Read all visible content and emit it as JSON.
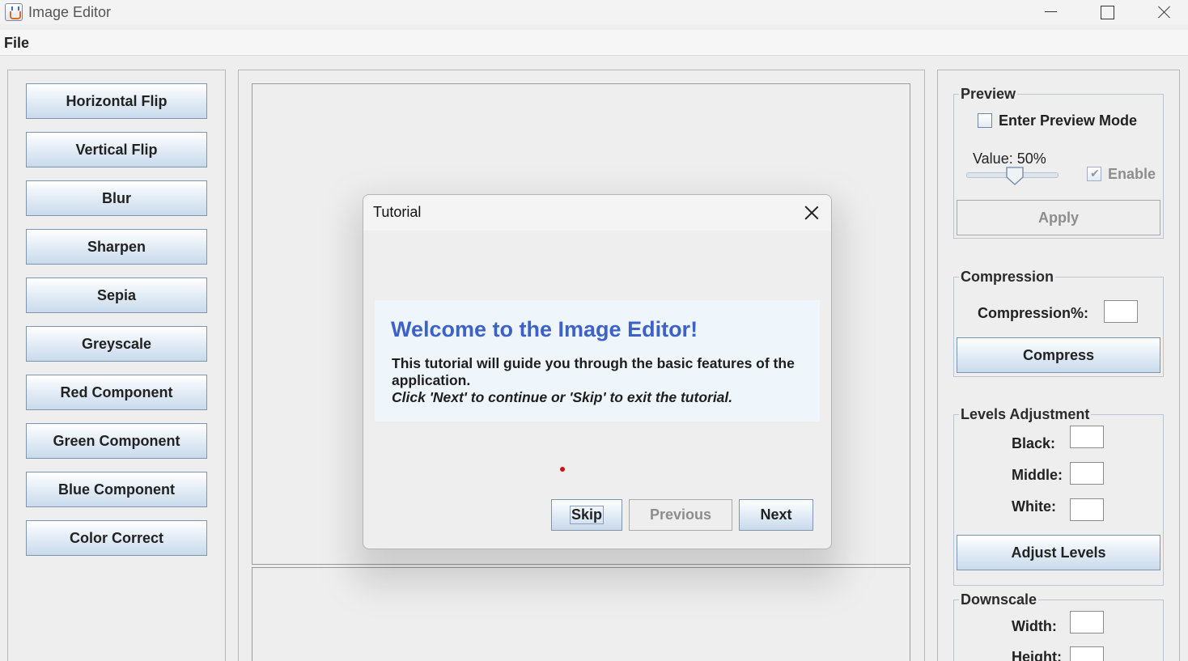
{
  "window": {
    "title": "Image Editor",
    "icon": "java-cup-icon"
  },
  "menu": {
    "file": "File"
  },
  "tools": [
    "Horizontal Flip",
    "Vertical Flip",
    "Blur",
    "Sharpen",
    "Sepia",
    "Greyscale",
    "Red Component",
    "Green Component",
    "Blue Component",
    "Color Correct"
  ],
  "preview": {
    "title": "Preview",
    "mode_label": "Enter Preview Mode",
    "mode_checked": false,
    "value_label": "Value: 50%",
    "value_percent": 50,
    "enable_label": "Enable",
    "enable_checked": true,
    "apply_label": "Apply"
  },
  "compression": {
    "title": "Compression",
    "label": "Compression%:",
    "value": "",
    "button": "Compress"
  },
  "levels": {
    "title": "Levels Adjustment",
    "black_label": "Black:",
    "middle_label": "Middle:",
    "white_label": "White:",
    "black": "",
    "middle": "",
    "white": "",
    "button": "Adjust Levels"
  },
  "downscale": {
    "title": "Downscale",
    "width_label": "Width:",
    "height_label": "Height:",
    "width": "",
    "height": ""
  },
  "dialog": {
    "title": "Tutorial",
    "heading": "Welcome to the Image Editor!",
    "body": "This tutorial will guide you through the basic features of the application.",
    "hint": "Click 'Next' to continue or 'Skip' to exit the tutorial.",
    "skip": "Skip",
    "previous": "Previous",
    "next": "Next"
  }
}
